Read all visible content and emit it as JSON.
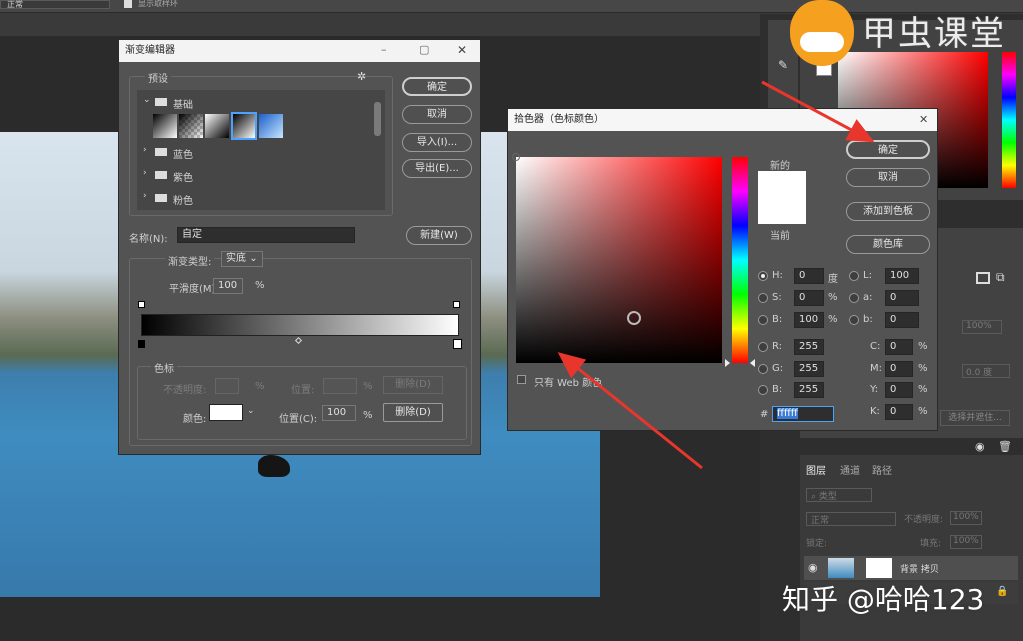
{
  "topbar": {
    "mode": "正常",
    "sample_label": "显示取样环"
  },
  "watermark": {
    "brand": "甲虫课堂",
    "credit": "知乎 @哈哈123"
  },
  "gradient_editor": {
    "title": "渐变编辑器",
    "preset_label": "预设",
    "folders": [
      "基础",
      "蓝色",
      "紫色",
      "粉色"
    ],
    "ok": "确定",
    "cancel": "取消",
    "import": "导入(I)...",
    "export": "导出(E)...",
    "name_label": "名称(N):",
    "name_value": "自定",
    "new": "新建(W)",
    "type_label": "渐变类型:",
    "type_value": "实底",
    "smooth_label": "平滑度(M):",
    "smooth_value": "100",
    "percent": "%",
    "stops_label": "色标",
    "opacity_label": "不透明度:",
    "position_label": "位置:",
    "delete": "删除(D)",
    "color_label": "颜色:",
    "position_c_label": "位置(C):",
    "position_value": "100"
  },
  "color_picker": {
    "title": "拾色器（色标颜色）",
    "new_label": "新的",
    "current_label": "当前",
    "ok": "确定",
    "cancel": "取消",
    "add_swatch": "添加到色板",
    "color_lib": "颜色库",
    "web_only": "只有 Web 颜色",
    "fields": {
      "H": "0",
      "S": "0",
      "B": "100",
      "R": "255",
      "G": "255",
      "Bb": "255",
      "L": "100",
      "a": "0",
      "b": "0",
      "C": "0",
      "M": "0",
      "Y": "0",
      "K": "0"
    },
    "deg": "度",
    "pct": "%",
    "hex_label": "#",
    "hex": "ffffff"
  },
  "right_panel": {
    "tabs": [
      "图层",
      "通道",
      "路径"
    ],
    "kind": "类型",
    "blend": "正常",
    "opacity_label": "不透明度:",
    "opacity_value": "100%",
    "lock_label": "锁定:",
    "fill_label": "填充:",
    "fill_value": "100%",
    "layer_name": "背景 拷贝",
    "percent_value": "100%",
    "degree_value": "0.0 度",
    "merge_label": "选择并遮住..."
  }
}
